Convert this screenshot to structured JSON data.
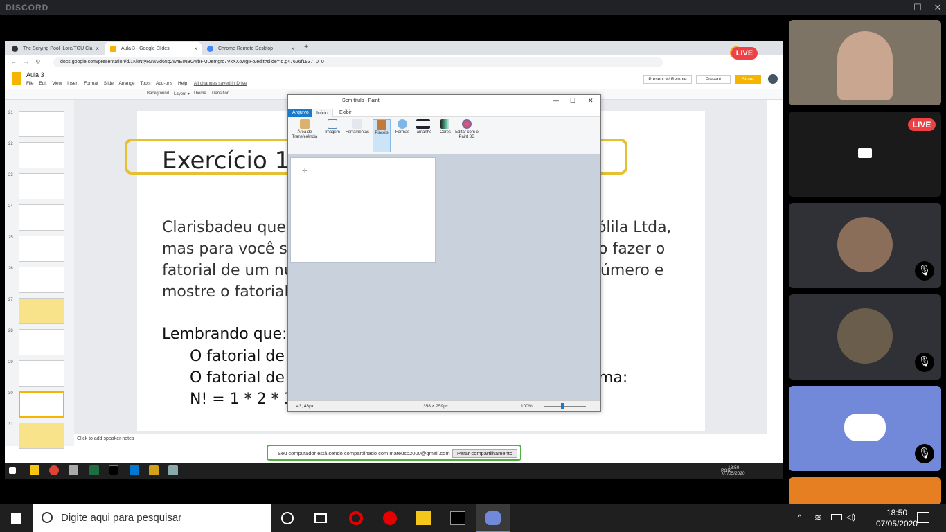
{
  "discord": {
    "logo": "DISCORD",
    "window_controls": [
      "—",
      "☐",
      "✕"
    ],
    "live_label": "LIVE",
    "warning_label": "!"
  },
  "browser": {
    "tabs": [
      {
        "label": "The Scrying Pool~Lore/TGU Cla",
        "close": "×"
      },
      {
        "label": "Aula 3 - Google Slides",
        "close": "×"
      },
      {
        "label": "Chrome Remote Desktop",
        "close": "×"
      }
    ],
    "new_tab": "+",
    "url": "docs.google.com/presentation/d/1NkNtyRZwVd6fIq2w4EINBGwbFMUemgrc7VxXXowgIFo/edit#slide=id.g47626f1937_0_0"
  },
  "slides": {
    "doc_title": "Aula 3",
    "menu": [
      "File",
      "Edit",
      "View",
      "Insert",
      "Format",
      "Slide",
      "Arrange",
      "Tools",
      "Add-ons",
      "Help"
    ],
    "saved_status": "All changes saved in Drive",
    "present_remote": "Present w/ Remote",
    "present": "Present",
    "share": "Share",
    "toolbar_items": [
      "Background",
      "Layout ▾",
      "Theme",
      "Transition"
    ],
    "thumbnail_numbers": [
      "21",
      "22",
      "23",
      "24",
      "25",
      "26",
      "27",
      "28",
      "29",
      "30",
      "31"
    ],
    "speaker_notes": "Click to add speaker notes",
    "slide_content": {
      "title": "Exercício 14 -",
      "body_lines": [
        "Clarisbadeu quer",
        "mas para você s",
        "fatorial de um nu",
        "mostre o fatorial"
      ],
      "body_right_lines": [
        "hólila Ltda,",
        "o fazer o",
        "número e"
      ],
      "lembrando": "Lembrando que:",
      "fatorial_lines": [
        "O fatorial de",
        "O fatorial de",
        "N! = 1 * 2 * 3"
      ],
      "forma": "ma:"
    }
  },
  "share_banner": {
    "text": "Seu computador está sendo compartilhado com mateusp2000@gmail.com",
    "stop_button": "Parar compartilhamento"
  },
  "inner_taskbar": {
    "time": "18:50",
    "date": "07/05/2020",
    "lang": "POR"
  },
  "paint": {
    "title": "Sem título - Paint",
    "tabs": [
      "Arquivo",
      "Início",
      "Exibir"
    ],
    "groups": [
      {
        "label": "Área de Transferência",
        "icon": "clipboard-icon"
      },
      {
        "label": "Imagem",
        "icon": "image-icon"
      },
      {
        "label": "Ferramentas",
        "icon": "tools-icon"
      },
      {
        "label": "Pincéis",
        "icon": "brush-icon"
      },
      {
        "label": "Formas",
        "icon": "shapes-icon"
      },
      {
        "label": "Tamanho",
        "icon": "size-icon"
      },
      {
        "label": "Cores",
        "icon": "colors-icon"
      },
      {
        "label": "Editar com o Paint 3D",
        "icon": "paint3d-icon"
      }
    ],
    "status": {
      "cursor": "43, 43px",
      "size": "358 × 259px",
      "zoom": "100%"
    }
  },
  "taskbar": {
    "search_placeholder": "Digite aqui para pesquisar",
    "time": "18:50",
    "date": "07/05/2020"
  },
  "colors": {
    "discord_dark": "#202225",
    "live_red": "#ed4245",
    "slide_title_border": "#e4c032",
    "share_green": "#52b043",
    "paint_blue": "#1979ca",
    "discord_blurple": "#7289da"
  }
}
